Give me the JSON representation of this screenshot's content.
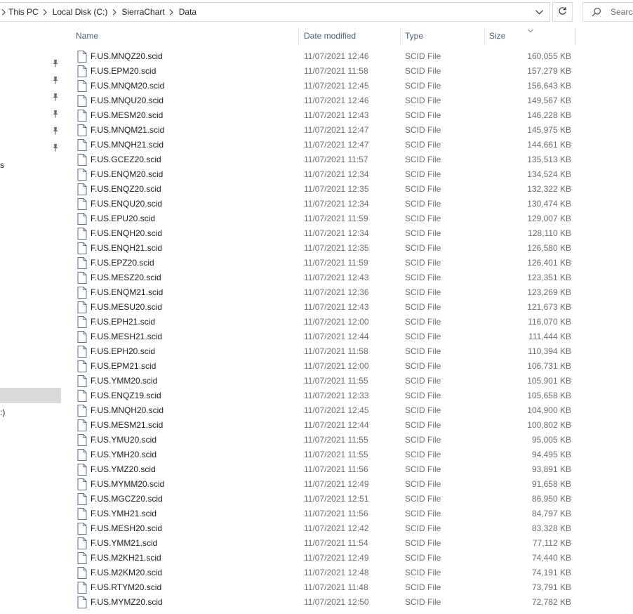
{
  "address_bar": {
    "crumbs": [
      "This PC",
      "Local Disk (C:)",
      "SierraChart",
      "Data"
    ]
  },
  "search": {
    "placeholder": "Search"
  },
  "nav": {
    "fragments": [
      {
        "text": "s"
      },
      {
        "text": ":)"
      }
    ]
  },
  "columns": {
    "name": "Name",
    "date": "Date modified",
    "type": "Type",
    "size": "Size"
  },
  "files": [
    {
      "name": "F.US.MNQZ20.scid",
      "date": "11/07/2021 12:46",
      "type": "SCID File",
      "size": "160,055 KB"
    },
    {
      "name": "F.US.EPM20.scid",
      "date": "11/07/2021 11:58",
      "type": "SCID File",
      "size": "157,279 KB"
    },
    {
      "name": "F.US.MNQM20.scid",
      "date": "11/07/2021 12:45",
      "type": "SCID File",
      "size": "156,643 KB"
    },
    {
      "name": "F.US.MNQU20.scid",
      "date": "11/07/2021 12:46",
      "type": "SCID File",
      "size": "149,567 KB"
    },
    {
      "name": "F.US.MESM20.scid",
      "date": "11/07/2021 12:43",
      "type": "SCID File",
      "size": "146,228 KB"
    },
    {
      "name": "F.US.MNQM21.scid",
      "date": "11/07/2021 12:47",
      "type": "SCID File",
      "size": "145,975 KB"
    },
    {
      "name": "F.US.MNQH21.scid",
      "date": "11/07/2021 12:47",
      "type": "SCID File",
      "size": "144,661 KB"
    },
    {
      "name": "F.US.GCEZ20.scid",
      "date": "11/07/2021 11:57",
      "type": "SCID File",
      "size": "135,513 KB"
    },
    {
      "name": "F.US.ENQM20.scid",
      "date": "11/07/2021 12:34",
      "type": "SCID File",
      "size": "134,524 KB"
    },
    {
      "name": "F.US.ENQZ20.scid",
      "date": "11/07/2021 12:35",
      "type": "SCID File",
      "size": "132,322 KB"
    },
    {
      "name": "F.US.ENQU20.scid",
      "date": "11/07/2021 12:34",
      "type": "SCID File",
      "size": "130,474 KB"
    },
    {
      "name": "F.US.EPU20.scid",
      "date": "11/07/2021 11:59",
      "type": "SCID File",
      "size": "129,007 KB"
    },
    {
      "name": "F.US.ENQH20.scid",
      "date": "11/07/2021 12:34",
      "type": "SCID File",
      "size": "128,110 KB"
    },
    {
      "name": "F.US.ENQH21.scid",
      "date": "11/07/2021 12:35",
      "type": "SCID File",
      "size": "126,580 KB"
    },
    {
      "name": "F.US.EPZ20.scid",
      "date": "11/07/2021 11:59",
      "type": "SCID File",
      "size": "126,401 KB"
    },
    {
      "name": "F.US.MESZ20.scid",
      "date": "11/07/2021 12:43",
      "type": "SCID File",
      "size": "123,351 KB"
    },
    {
      "name": "F.US.ENQM21.scid",
      "date": "11/07/2021 12:36",
      "type": "SCID File",
      "size": "123,269 KB"
    },
    {
      "name": "F.US.MESU20.scid",
      "date": "11/07/2021 12:43",
      "type": "SCID File",
      "size": "121,673 KB"
    },
    {
      "name": "F.US.EPH21.scid",
      "date": "11/07/2021 12:00",
      "type": "SCID File",
      "size": "116,070 KB"
    },
    {
      "name": "F.US.MESH21.scid",
      "date": "11/07/2021 12:44",
      "type": "SCID File",
      "size": "111,444 KB"
    },
    {
      "name": "F.US.EPH20.scid",
      "date": "11/07/2021 11:58",
      "type": "SCID File",
      "size": "110,394 KB"
    },
    {
      "name": "F.US.EPM21.scid",
      "date": "11/07/2021 12:00",
      "type": "SCID File",
      "size": "106,731 KB"
    },
    {
      "name": "F.US.YMM20.scid",
      "date": "11/07/2021 11:55",
      "type": "SCID File",
      "size": "105,901 KB"
    },
    {
      "name": "F.US.ENQZ19.scid",
      "date": "11/07/2021 12:33",
      "type": "SCID File",
      "size": "105,658 KB"
    },
    {
      "name": "F.US.MNQH20.scid",
      "date": "11/07/2021 12:45",
      "type": "SCID File",
      "size": "104,900 KB"
    },
    {
      "name": "F.US.MESM21.scid",
      "date": "11/07/2021 12:44",
      "type": "SCID File",
      "size": "100,802 KB"
    },
    {
      "name": "F.US.YMU20.scid",
      "date": "11/07/2021 11:55",
      "type": "SCID File",
      "size": "95,005 KB"
    },
    {
      "name": "F.US.YMH20.scid",
      "date": "11/07/2021 11:55",
      "type": "SCID File",
      "size": "94,495 KB"
    },
    {
      "name": "F.US.YMZ20.scid",
      "date": "11/07/2021 11:56",
      "type": "SCID File",
      "size": "93,891 KB"
    },
    {
      "name": "F.US.MYMM20.scid",
      "date": "11/07/2021 12:49",
      "type": "SCID File",
      "size": "91,658 KB"
    },
    {
      "name": "F.US.MGCZ20.scid",
      "date": "11/07/2021 12:51",
      "type": "SCID File",
      "size": "86,950 KB"
    },
    {
      "name": "F.US.YMH21.scid",
      "date": "11/07/2021 11:56",
      "type": "SCID File",
      "size": "84,797 KB"
    },
    {
      "name": "F.US.MESH20.scid",
      "date": "11/07/2021 12:42",
      "type": "SCID File",
      "size": "83,328 KB"
    },
    {
      "name": "F.US.YMM21.scid",
      "date": "11/07/2021 11:54",
      "type": "SCID File",
      "size": "77,112 KB"
    },
    {
      "name": "F.US.M2KH21.scid",
      "date": "11/07/2021 12:49",
      "type": "SCID File",
      "size": "74,440 KB"
    },
    {
      "name": "F.US.M2KM20.scid",
      "date": "11/07/2021 12:48",
      "type": "SCID File",
      "size": "74,191 KB"
    },
    {
      "name": "F.US.RTYM20.scid",
      "date": "11/07/2021 11:48",
      "type": "SCID File",
      "size": "73,791 KB"
    },
    {
      "name": "F.US.MYMZ20.scid",
      "date": "11/07/2021 12:50",
      "type": "SCID File",
      "size": "72,782 KB"
    }
  ],
  "icons": {
    "file": "document-icon",
    "pin": "pin-icon",
    "search": "search-icon",
    "refresh": "refresh-icon",
    "dropdown": "chevron-down-icon",
    "separator": "chevron-right-icon"
  },
  "colors": {
    "selection": "#d9d9d9",
    "header_text": "#4c607a",
    "secondary_text": "#6d6d6d"
  }
}
